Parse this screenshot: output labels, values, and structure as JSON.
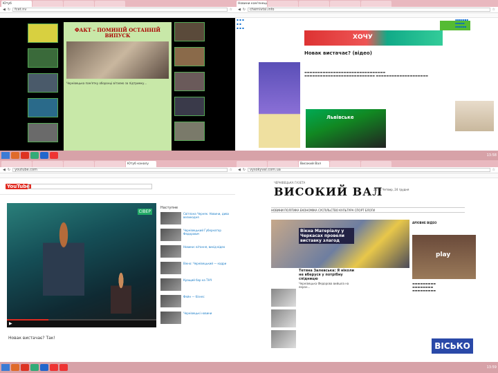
{
  "taskbar": {
    "clock_mid": "13:58",
    "clock_bot": "13:59"
  },
  "colors": {
    "taskbar": "#d7a2a8",
    "youtube_red": "#e02a20",
    "tl_main": "#c8e8a8"
  },
  "top_left": {
    "tab": "Ютуб",
    "url": "fcet.nv",
    "headline": "ФАКТ – ПОМИНІЙ ОСТАННІЙ ВИПУСК",
    "body": "Чернівецька пам'ятку оборонці вітаємо за підтримку…"
  },
  "top_right": {
    "tab": "Новини кам'янецької",
    "url": "chernivtsi.info",
    "headline": "Новак вистачає? (відео)",
    "banner": "ХОЧУ",
    "video_brand": "Львівське"
  },
  "bottom_left": {
    "tab": "Ютуб каналу",
    "url": "youtube.com",
    "logo": "YouTube",
    "channel": "СІВЕР",
    "video_title": "Новак вистачає? Так!",
    "related_header": "Наступне",
    "related": [
      "Світлана Черняк. Новини, дива великодня",
      "Чернівецький Губернатор Федорович",
      "Новини: вітання, вихід відео",
      "Вікно: Чернівецький — кадри",
      "Кращий бар на ТНЧ",
      "Фейн — бізнес",
      "Чернівецькі новини"
    ]
  },
  "bottom_right": {
    "tab": "Високий Вал",
    "url": "vysokyval.com.ua",
    "masthead": "ВИСОКИЙ ВАЛ",
    "pretitle": "ЧЕРНІВЕЦЬКА ГАЗЕТА",
    "date": "21:05 Четвер, 24 грудня",
    "nav": "НОВИНИ  ПОЛІТИКА  ЕКОНОМІКА  СУСПІЛЬСТВО  КУЛЬТУРА  СПОРТ  БЛОГИ",
    "lead_headline": "Вікна Матеріалу у Черкасах провели виставку злагод",
    "sub_headline": "Тетяна Залевська: Я ніколи не вберуся у потрібну спідницю",
    "sub_text": "Чернівецька Федорова вийшла на екран…",
    "section": "АРХІВНЕ ВІДЕО",
    "tv": "play",
    "ad": "ВІСЬКО"
  }
}
